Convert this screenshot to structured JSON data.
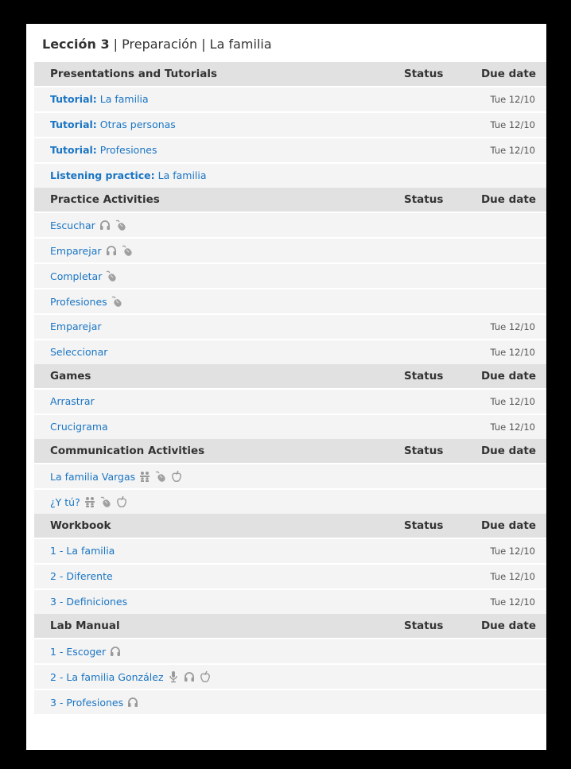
{
  "header": {
    "lesson": "Lección 3",
    "sep1": " | ",
    "part": "Preparación",
    "sep2": " | ",
    "topic": "La familia"
  },
  "columns": {
    "status": "Status",
    "due": "Due date"
  },
  "sections": [
    {
      "title": "Presentations and Tutorials",
      "rows": [
        {
          "prefix": "Tutorial:",
          "text": " La familia",
          "due": "Tue 12/10",
          "icons": []
        },
        {
          "prefix": "Tutorial:",
          "text": " Otras personas",
          "due": "Tue 12/10",
          "icons": []
        },
        {
          "prefix": "Tutorial:",
          "text": " Profesiones",
          "due": "Tue 12/10",
          "icons": []
        },
        {
          "prefix": "Listening practice:",
          "text": " La familia",
          "due": "",
          "icons": []
        }
      ]
    },
    {
      "title": "Practice Activities",
      "rows": [
        {
          "prefix": "",
          "text": "Escuchar",
          "due": "",
          "icons": [
            "headphones-icon",
            "mouse-icon"
          ]
        },
        {
          "prefix": "",
          "text": "Emparejar",
          "due": "",
          "icons": [
            "headphones-icon",
            "mouse-icon"
          ]
        },
        {
          "prefix": "",
          "text": "Completar",
          "due": "",
          "icons": [
            "mouse-icon"
          ]
        },
        {
          "prefix": "",
          "text": "Profesiones",
          "due": "",
          "icons": [
            "mouse-icon"
          ]
        },
        {
          "prefix": "",
          "text": "Emparejar",
          "due": "Tue 12/10",
          "icons": []
        },
        {
          "prefix": "",
          "text": "Seleccionar",
          "due": "Tue 12/10",
          "icons": []
        }
      ]
    },
    {
      "title": "Games",
      "rows": [
        {
          "prefix": "",
          "text": "Arrastrar",
          "due": "Tue 12/10",
          "icons": []
        },
        {
          "prefix": "",
          "text": "Crucigrama",
          "due": "Tue 12/10",
          "icons": []
        }
      ]
    },
    {
      "title": "Communication Activities",
      "rows": [
        {
          "prefix": "",
          "text": "La familia Vargas",
          "due": "",
          "icons": [
            "group-icon",
            "mouse-icon",
            "apple-icon"
          ]
        },
        {
          "prefix": "",
          "text": "¿Y tú?",
          "due": "",
          "icons": [
            "group-icon",
            "mouse-icon",
            "apple-icon"
          ]
        }
      ]
    },
    {
      "title": "Workbook",
      "rows": [
        {
          "prefix": "",
          "text": "1 - La familia",
          "due": "Tue 12/10",
          "icons": []
        },
        {
          "prefix": "",
          "text": "2 - Diferente",
          "due": "Tue 12/10",
          "icons": []
        },
        {
          "prefix": "",
          "text": "3 - Definiciones",
          "due": "Tue 12/10",
          "icons": []
        }
      ]
    },
    {
      "title": "Lab Manual",
      "rows": [
        {
          "prefix": "",
          "text": "1 - Escoger",
          "due": "",
          "icons": [
            "headphones-icon"
          ]
        },
        {
          "prefix": "",
          "text": "2 - La familia González",
          "due": "",
          "icons": [
            "microphone-icon",
            "headphones-icon",
            "apple-icon"
          ]
        },
        {
          "prefix": "",
          "text": "3 - Profesiones",
          "due": "",
          "icons": [
            "headphones-icon"
          ]
        }
      ]
    }
  ]
}
